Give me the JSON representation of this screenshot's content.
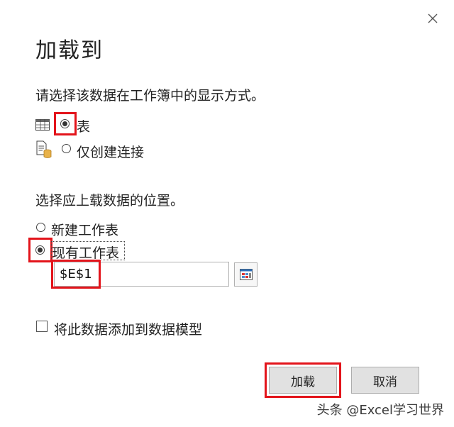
{
  "dialog": {
    "title": "加载到",
    "close_icon": "close-icon"
  },
  "display_section": {
    "prompt": "请选择该数据在工作簿中的显示方式。",
    "options": [
      {
        "label": "表",
        "icon": "table-icon",
        "selected": true
      },
      {
        "label": "仅创建连接",
        "icon": "connection-only-icon",
        "selected": false
      }
    ]
  },
  "location_section": {
    "prompt": "选择应上载数据的位置。",
    "options": [
      {
        "label": "新建工作表",
        "selected": false
      },
      {
        "label": "现有工作表",
        "selected": true
      }
    ],
    "cell_reference": "$E$1",
    "range_picker_icon": "range-select-icon"
  },
  "data_model_checkbox": {
    "label": "将此数据添加到数据模型",
    "checked": false
  },
  "buttons": {
    "load": "加载",
    "cancel": "取消"
  },
  "watermark": "头条 @Excel学习世界",
  "colors": {
    "highlight": "#e3141b",
    "button_face": "#e1e1e1"
  }
}
